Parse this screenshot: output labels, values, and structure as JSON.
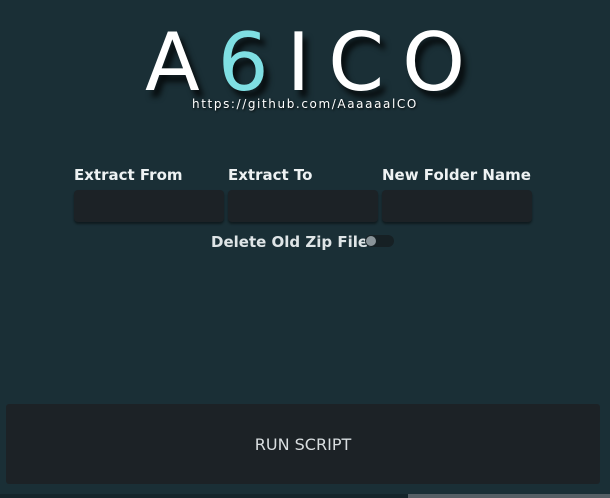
{
  "logo": {
    "prefix": "A",
    "accent": "6",
    "suffix": "ICO",
    "url": "https://github.com/AaaaaalCO"
  },
  "form": {
    "fields": [
      {
        "label": "Extract From",
        "value": ""
      },
      {
        "label": "Extract To",
        "value": ""
      },
      {
        "label": "New Folder Name",
        "value": ""
      }
    ],
    "toggle": {
      "label": "Delete Old Zip Files",
      "checked": false
    }
  },
  "run_button": {
    "label": "RUN SCRIPT"
  },
  "colors": {
    "background": "#1a2f36",
    "accent": "#7fdfe3",
    "input_bg": "#1c2226"
  }
}
